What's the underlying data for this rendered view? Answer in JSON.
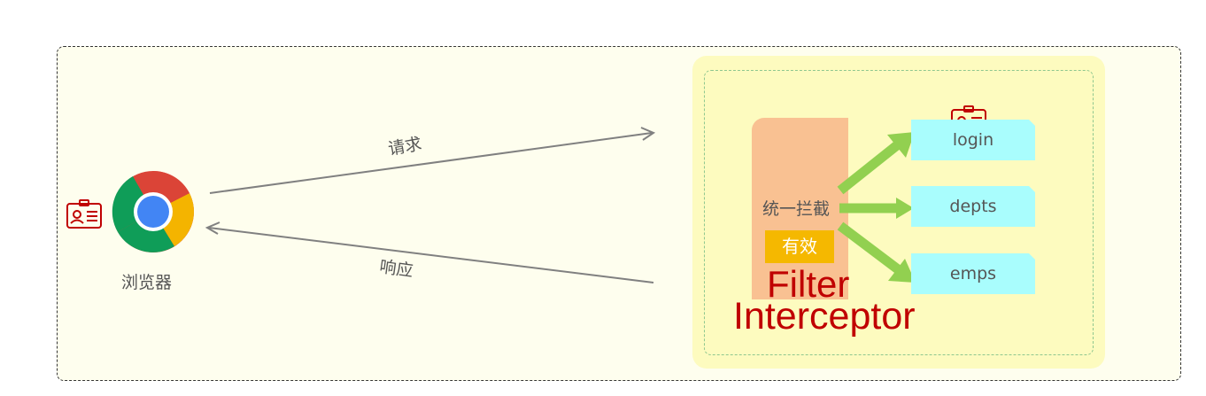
{
  "browser": {
    "label": "浏览器",
    "icon": "chrome-browser-icon",
    "badge_icon": "id-card-icon"
  },
  "arrows": {
    "request_label": "请求",
    "response_label": "响应"
  },
  "server": {
    "intercept_label": "统一拦截",
    "valid_badge": "有效",
    "filter_label": "Filter",
    "interceptor_label": "Interceptor",
    "badge_icon": "id-card-icon",
    "endpoints": [
      {
        "label": "login"
      },
      {
        "label": "depts"
      },
      {
        "label": "emps"
      }
    ]
  },
  "colors": {
    "outer_background": "#fefeee",
    "server_background": "#fdfbbf",
    "filter_block": "#f9c192",
    "endpoint_background": "#a9fdfd",
    "valid_badge": "#f5b800",
    "brand_red": "#c00000",
    "arrow_green": "#92d050",
    "id_card_red": "#c00000"
  }
}
